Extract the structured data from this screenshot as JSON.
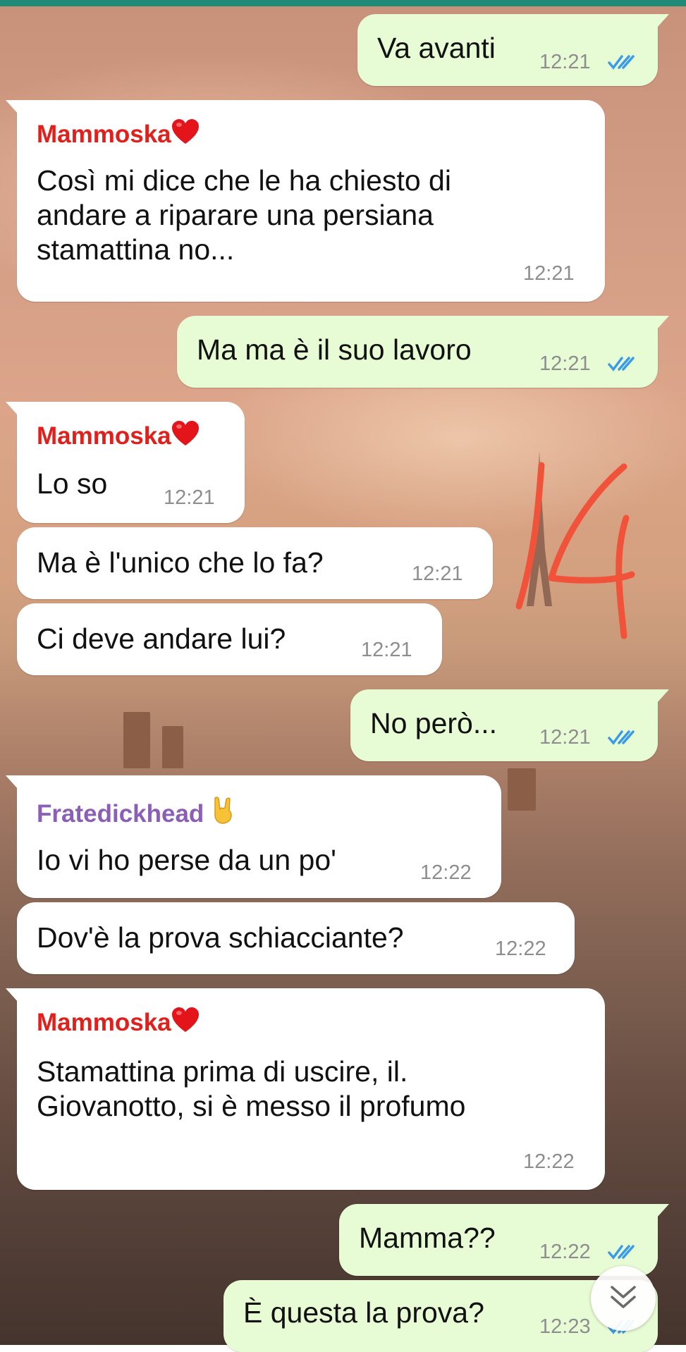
{
  "chat": {
    "messages": [
      {
        "direction": "out",
        "text": "Va avanti",
        "time": "12:21",
        "status": "read-double-check-icon"
      },
      {
        "direction": "in",
        "sender": "Mammoska",
        "sender_emoji": "heart-icon",
        "text": "Così mi dice che le ha chiesto di\nandare a riparare una persiana\nstamattina no...",
        "time": "12:21"
      },
      {
        "direction": "out",
        "text": "Ma ma è il suo lavoro",
        "time": "12:21",
        "status": "read-double-check-icon"
      },
      {
        "direction": "in",
        "sender": "Mammoska",
        "sender_emoji": "heart-icon",
        "text": "Lo so",
        "time": "12:21"
      },
      {
        "direction": "in",
        "text": "Ma è l'unico che lo fa?",
        "time": "12:21"
      },
      {
        "direction": "in",
        "text": "Ci deve andare lui?",
        "time": "12:21"
      },
      {
        "direction": "out",
        "text": "No però...",
        "time": "12:21",
        "status": "read-double-check-icon"
      },
      {
        "direction": "in",
        "sender": "Fratedickhead",
        "sender_emoji": "rock-hand-icon",
        "text": "Io vi ho perse da un po'",
        "time": "12:22"
      },
      {
        "direction": "in",
        "text": "Dov'è la prova schiacciante?",
        "time": "12:22"
      },
      {
        "direction": "in",
        "sender": "Mammoska",
        "sender_emoji": "heart-icon",
        "text": "Stamattina prima di uscire, il.\nGiovanotto, si è messo il profumo",
        "time": "12:22"
      },
      {
        "direction": "out",
        "text": "Mamma??",
        "time": "12:22",
        "status": "read-double-check-icon"
      },
      {
        "direction": "out",
        "text": "È questa la prova?",
        "time": "12:23",
        "status": "read-double-check-icon"
      }
    ]
  },
  "colors": {
    "incoming_bubble": "#ffffff",
    "outgoing_bubble": "#e7fbd4",
    "sender_mammoska": "#e0201c",
    "sender_fratedickhead": "#8a5fb5",
    "read_ticks": "#3a9be8",
    "annotation_stroke": "#f0533a"
  },
  "annotation": {
    "icon": "handwritten-14-mark"
  },
  "scroll_button": {
    "icon": "double-chevron-down-icon"
  }
}
